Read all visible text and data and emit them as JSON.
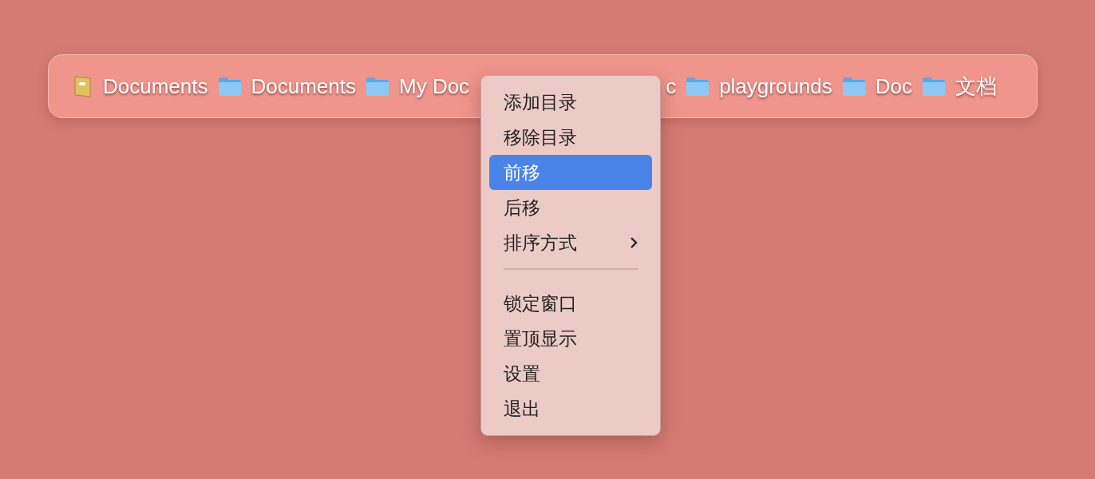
{
  "path_bar": [
    {
      "kind": "notebook",
      "label": "Documents"
    },
    {
      "kind": "folder",
      "label": "Documents"
    },
    {
      "kind": "folder",
      "label": "My Doc"
    },
    {
      "kind": "covered",
      "label": "c"
    },
    {
      "kind": "folder",
      "label": "playgrounds"
    },
    {
      "kind": "folder",
      "label": "Doc"
    },
    {
      "kind": "folder",
      "label": "文档"
    }
  ],
  "context_menu": [
    {
      "kind": "item",
      "label": "添加目录",
      "selected": false
    },
    {
      "kind": "item",
      "label": "移除目录",
      "selected": false
    },
    {
      "kind": "item",
      "label": "前移",
      "selected": true
    },
    {
      "kind": "item",
      "label": "后移",
      "selected": false
    },
    {
      "kind": "submenu",
      "label": "排序方式",
      "selected": false
    },
    {
      "kind": "separator"
    },
    {
      "kind": "item",
      "label": "锁定窗口",
      "selected": false
    },
    {
      "kind": "item",
      "label": "置顶显示",
      "selected": false
    },
    {
      "kind": "item",
      "label": "设置",
      "selected": false
    },
    {
      "kind": "item",
      "label": "退出",
      "selected": false
    }
  ]
}
